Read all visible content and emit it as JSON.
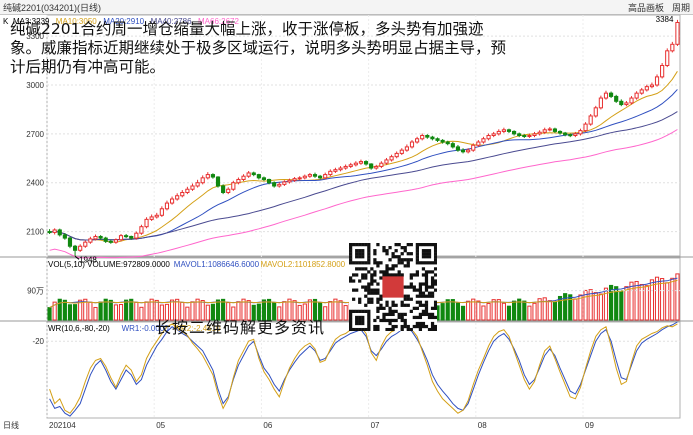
{
  "header": {
    "title": "纯碱2201(034201)(日线)",
    "btn_chart": "高品画板",
    "btn_period": "周期"
  },
  "ma_legend": [
    {
      "label": "K",
      "color": "#000000"
    },
    {
      "label": "MA3:3239",
      "color": "#000000"
    },
    {
      "label": "MA10:3050",
      "color": "#d4a017"
    },
    {
      "label": "MA20:2910",
      "color": "#3050c0"
    },
    {
      "label": "MA40:2786",
      "color": "#4a4a90"
    },
    {
      "label": "MA66:2672",
      "color": "#ff66cc"
    }
  ],
  "vol_legend": [
    {
      "label": "VOL(5,10) VOLUME:972809.0000",
      "color": "#000000"
    },
    {
      "label": "MAVOL1:1086646.6000",
      "color": "#3050c0"
    },
    {
      "label": "MAVOL2:1101852.8000",
      "color": "#d4a017"
    }
  ],
  "wr_legend": [
    {
      "label": "WR(10,6,-80,-20)",
      "color": "#000000"
    },
    {
      "label": "WR1:-0.0000",
      "color": "#3050c0"
    },
    {
      "label": "WR2:-2.4510",
      "color": "#d4a017"
    }
  ],
  "commentary": "纯碱2201合约周一增仓缩量大幅上涨，收于涨停板，多头势有加强迹象。威廉指标近期继续处于极多区域运行，说明多头势明显占据主导，预计后期仍有冲高可能。",
  "qr_caption": "长按二维码解更多资讯",
  "bottom_left_label": "日线",
  "colors": {
    "up": "#e83030",
    "down": "#118811",
    "ma10": "#d4a017",
    "ma20": "#3050c0",
    "ma40": "#4a4a90",
    "ma66": "#ff66cc"
  },
  "chart_data": [
    {
      "type": "candlestick",
      "title": "",
      "y_ticks": [
        2100,
        2400,
        2700,
        3000,
        3300
      ],
      "ylim": [
        1950,
        3430
      ],
      "x_ticks": [
        "202104",
        "05",
        "06",
        "07",
        "08",
        "09"
      ],
      "annotations": [
        {
          "label": "1948",
          "index": 5
        },
        {
          "label": "3384",
          "index": 123
        }
      ],
      "open": [
        2100,
        2095,
        2110,
        2080,
        2060,
        2010,
        1985,
        2010,
        2035,
        2055,
        2070,
        2060,
        2040,
        2035,
        2050,
        2075,
        2070,
        2060,
        2090,
        2130,
        2175,
        2190,
        2200,
        2240,
        2275,
        2300,
        2320,
        2340,
        2360,
        2380,
        2400,
        2430,
        2450,
        2435,
        2380,
        2340,
        2360,
        2400,
        2420,
        2440,
        2460,
        2450,
        2430,
        2420,
        2400,
        2380,
        2390,
        2405,
        2415,
        2425,
        2430,
        2440,
        2450,
        2440,
        2430,
        2450,
        2470,
        2480,
        2490,
        2500,
        2510,
        2520,
        2530,
        2515,
        2490,
        2500,
        2520,
        2540,
        2560,
        2580,
        2600,
        2620,
        2650,
        2670,
        2690,
        2680,
        2670,
        2660,
        2650,
        2640,
        2620,
        2600,
        2590,
        2600,
        2630,
        2650,
        2670,
        2690,
        2700,
        2715,
        2725,
        2715,
        2700,
        2690,
        2685,
        2690,
        2700,
        2710,
        2725,
        2730,
        2715,
        2705,
        2695,
        2690,
        2700,
        2720,
        2760,
        2810,
        2860,
        2920,
        2950,
        2930,
        2900,
        2880,
        2890,
        2920,
        2950,
        2970,
        2990,
        3000,
        3050,
        3120,
        3210,
        3250
      ],
      "close": [
        2095,
        2110,
        2080,
        2060,
        2010,
        1985,
        2010,
        2035,
        2055,
        2070,
        2060,
        2040,
        2035,
        2050,
        2075,
        2070,
        2060,
        2090,
        2130,
        2175,
        2190,
        2200,
        2240,
        2275,
        2300,
        2320,
        2340,
        2360,
        2380,
        2400,
        2430,
        2450,
        2435,
        2380,
        2340,
        2360,
        2400,
        2420,
        2440,
        2460,
        2450,
        2430,
        2420,
        2400,
        2380,
        2390,
        2405,
        2415,
        2425,
        2430,
        2440,
        2450,
        2440,
        2430,
        2450,
        2470,
        2480,
        2490,
        2500,
        2510,
        2520,
        2530,
        2515,
        2490,
        2500,
        2520,
        2540,
        2560,
        2580,
        2600,
        2620,
        2650,
        2670,
        2690,
        2680,
        2670,
        2660,
        2650,
        2640,
        2620,
        2600,
        2590,
        2600,
        2630,
        2650,
        2670,
        2690,
        2700,
        2715,
        2725,
        2715,
        2700,
        2690,
        2685,
        2690,
        2700,
        2710,
        2725,
        2730,
        2715,
        2705,
        2695,
        2690,
        2700,
        2720,
        2760,
        2810,
        2860,
        2920,
        2950,
        2930,
        2900,
        2880,
        2890,
        2920,
        2950,
        2970,
        2990,
        3000,
        3050,
        3120,
        3210,
        3250,
        3384
      ],
      "high": [
        2115,
        2120,
        2118,
        2090,
        2068,
        2018,
        2022,
        2045,
        2068,
        2082,
        2078,
        2068,
        2050,
        2058,
        2085,
        2085,
        2075,
        2100,
        2142,
        2188,
        2205,
        2215,
        2255,
        2290,
        2315,
        2335,
        2355,
        2375,
        2395,
        2418,
        2445,
        2465,
        2458,
        2440,
        2390,
        2372,
        2412,
        2432,
        2452,
        2472,
        2468,
        2455,
        2438,
        2425,
        2408,
        2402,
        2415,
        2425,
        2435,
        2440,
        2450,
        2460,
        2462,
        2448,
        2462,
        2482,
        2492,
        2502,
        2512,
        2522,
        2532,
        2542,
        2538,
        2520,
        2510,
        2532,
        2552,
        2572,
        2592,
        2612,
        2635,
        2662,
        2682,
        2702,
        2698,
        2688,
        2678,
        2668,
        2658,
        2650,
        2632,
        2612,
        2612,
        2642,
        2662,
        2682,
        2702,
        2712,
        2728,
        2738,
        2732,
        2722,
        2708,
        2698,
        2702,
        2712,
        2722,
        2738,
        2742,
        2738,
        2722,
        2712,
        2702,
        2712,
        2732,
        2772,
        2822,
        2872,
        2935,
        2965,
        2960,
        2940,
        2912,
        2902,
        2932,
        2962,
        2982,
        3002,
        3015,
        3065,
        3135,
        3225,
        3265,
        3400
      ],
      "low": [
        2085,
        2082,
        2070,
        2050,
        1998,
        1948,
        1975,
        2000,
        2025,
        2045,
        2050,
        2030,
        2025,
        2025,
        2040,
        2060,
        2050,
        2050,
        2080,
        2120,
        2165,
        2180,
        2190,
        2230,
        2265,
        2290,
        2310,
        2330,
        2350,
        2370,
        2390,
        2420,
        2425,
        2370,
        2330,
        2330,
        2350,
        2390,
        2410,
        2430,
        2440,
        2420,
        2410,
        2390,
        2370,
        2370,
        2380,
        2395,
        2405,
        2415,
        2420,
        2430,
        2430,
        2420,
        2420,
        2440,
        2460,
        2470,
        2480,
        2490,
        2500,
        2510,
        2505,
        2480,
        2480,
        2490,
        2510,
        2530,
        2550,
        2570,
        2590,
        2610,
        2640,
        2660,
        2670,
        2660,
        2650,
        2640,
        2630,
        2610,
        2590,
        2580,
        2580,
        2590,
        2620,
        2640,
        2660,
        2680,
        2690,
        2705,
        2705,
        2690,
        2680,
        2675,
        2675,
        2680,
        2690,
        2700,
        2715,
        2705,
        2695,
        2685,
        2680,
        2680,
        2690,
        2710,
        2750,
        2800,
        2850,
        2910,
        2920,
        2890,
        2870,
        2870,
        2880,
        2910,
        2940,
        2960,
        2980,
        2990,
        3040,
        3110,
        3200,
        3240
      ]
    },
    {
      "type": "bar",
      "title": "VOL",
      "y_ticks": [
        {
          "label": "90万",
          "value": 900000
        }
      ],
      "ylim": [
        0,
        1900000
      ]
    },
    {
      "type": "line",
      "title": "WR",
      "y_ticks": [
        {
          "label": "-20",
          "value": -20
        }
      ],
      "ylim": [
        -100,
        0
      ],
      "series": [
        {
          "name": "WR1",
          "values": [
            -80,
            -90,
            -88,
            -95,
            -98,
            -92,
            -85,
            -70,
            -55,
            -45,
            -40,
            -50,
            -62,
            -70,
            -60,
            -50,
            -55,
            -65,
            -60,
            -45,
            -35,
            -25,
            -18,
            -10,
            -5,
            -8,
            -12,
            -15,
            -20,
            -25,
            -30,
            -40,
            -50,
            -70,
            -85,
            -78,
            -60,
            -45,
            -35,
            -25,
            -20,
            -35,
            -48,
            -55,
            -65,
            -72,
            -60,
            -50,
            -42,
            -35,
            -30,
            -25,
            -30,
            -40,
            -38,
            -30,
            -22,
            -18,
            -15,
            -12,
            -10,
            -8,
            -15,
            -30,
            -35,
            -28,
            -20,
            -15,
            -12,
            -8,
            -5,
            -10,
            -18,
            -28,
            -40,
            -55,
            -65,
            -72,
            -78,
            -85,
            -90,
            -92,
            -85,
            -70,
            -55,
            -42,
            -30,
            -20,
            -15,
            -12,
            -18,
            -28,
            -40,
            -55,
            -65,
            -60,
            -48,
            -35,
            -28,
            -35,
            -48,
            -60,
            -72,
            -75,
            -65,
            -50,
            -35,
            -20,
            -12,
            -8,
            -20,
            -40,
            -58,
            -60,
            -45,
            -30,
            -22,
            -18,
            -15,
            -12,
            -8,
            -5,
            -3,
            0
          ]
        },
        {
          "name": "WR2",
          "values": [
            -70,
            -85,
            -80,
            -92,
            -95,
            -88,
            -78,
            -62,
            -48,
            -40,
            -38,
            -46,
            -58,
            -68,
            -55,
            -45,
            -50,
            -62,
            -55,
            -38,
            -28,
            -20,
            -12,
            -5,
            -2,
            -5,
            -10,
            -14,
            -22,
            -28,
            -35,
            -45,
            -55,
            -75,
            -90,
            -80,
            -58,
            -40,
            -30,
            -20,
            -18,
            -38,
            -52,
            -60,
            -70,
            -78,
            -62,
            -48,
            -38,
            -30,
            -25,
            -22,
            -28,
            -42,
            -40,
            -28,
            -18,
            -14,
            -12,
            -8,
            -6,
            -5,
            -12,
            -32,
            -40,
            -25,
            -15,
            -10,
            -8,
            -5,
            -3,
            -8,
            -15,
            -30,
            -45,
            -62,
            -72,
            -80,
            -85,
            -90,
            -95,
            -92,
            -82,
            -65,
            -50,
            -38,
            -25,
            -15,
            -10,
            -8,
            -15,
            -30,
            -45,
            -60,
            -70,
            -62,
            -45,
            -30,
            -25,
            -38,
            -52,
            -65,
            -78,
            -80,
            -68,
            -48,
            -30,
            -15,
            -8,
            -5,
            -25,
            -48,
            -65,
            -62,
            -42,
            -25,
            -18,
            -15,
            -12,
            -10,
            -6,
            -4,
            -5,
            -2
          ]
        }
      ]
    }
  ]
}
